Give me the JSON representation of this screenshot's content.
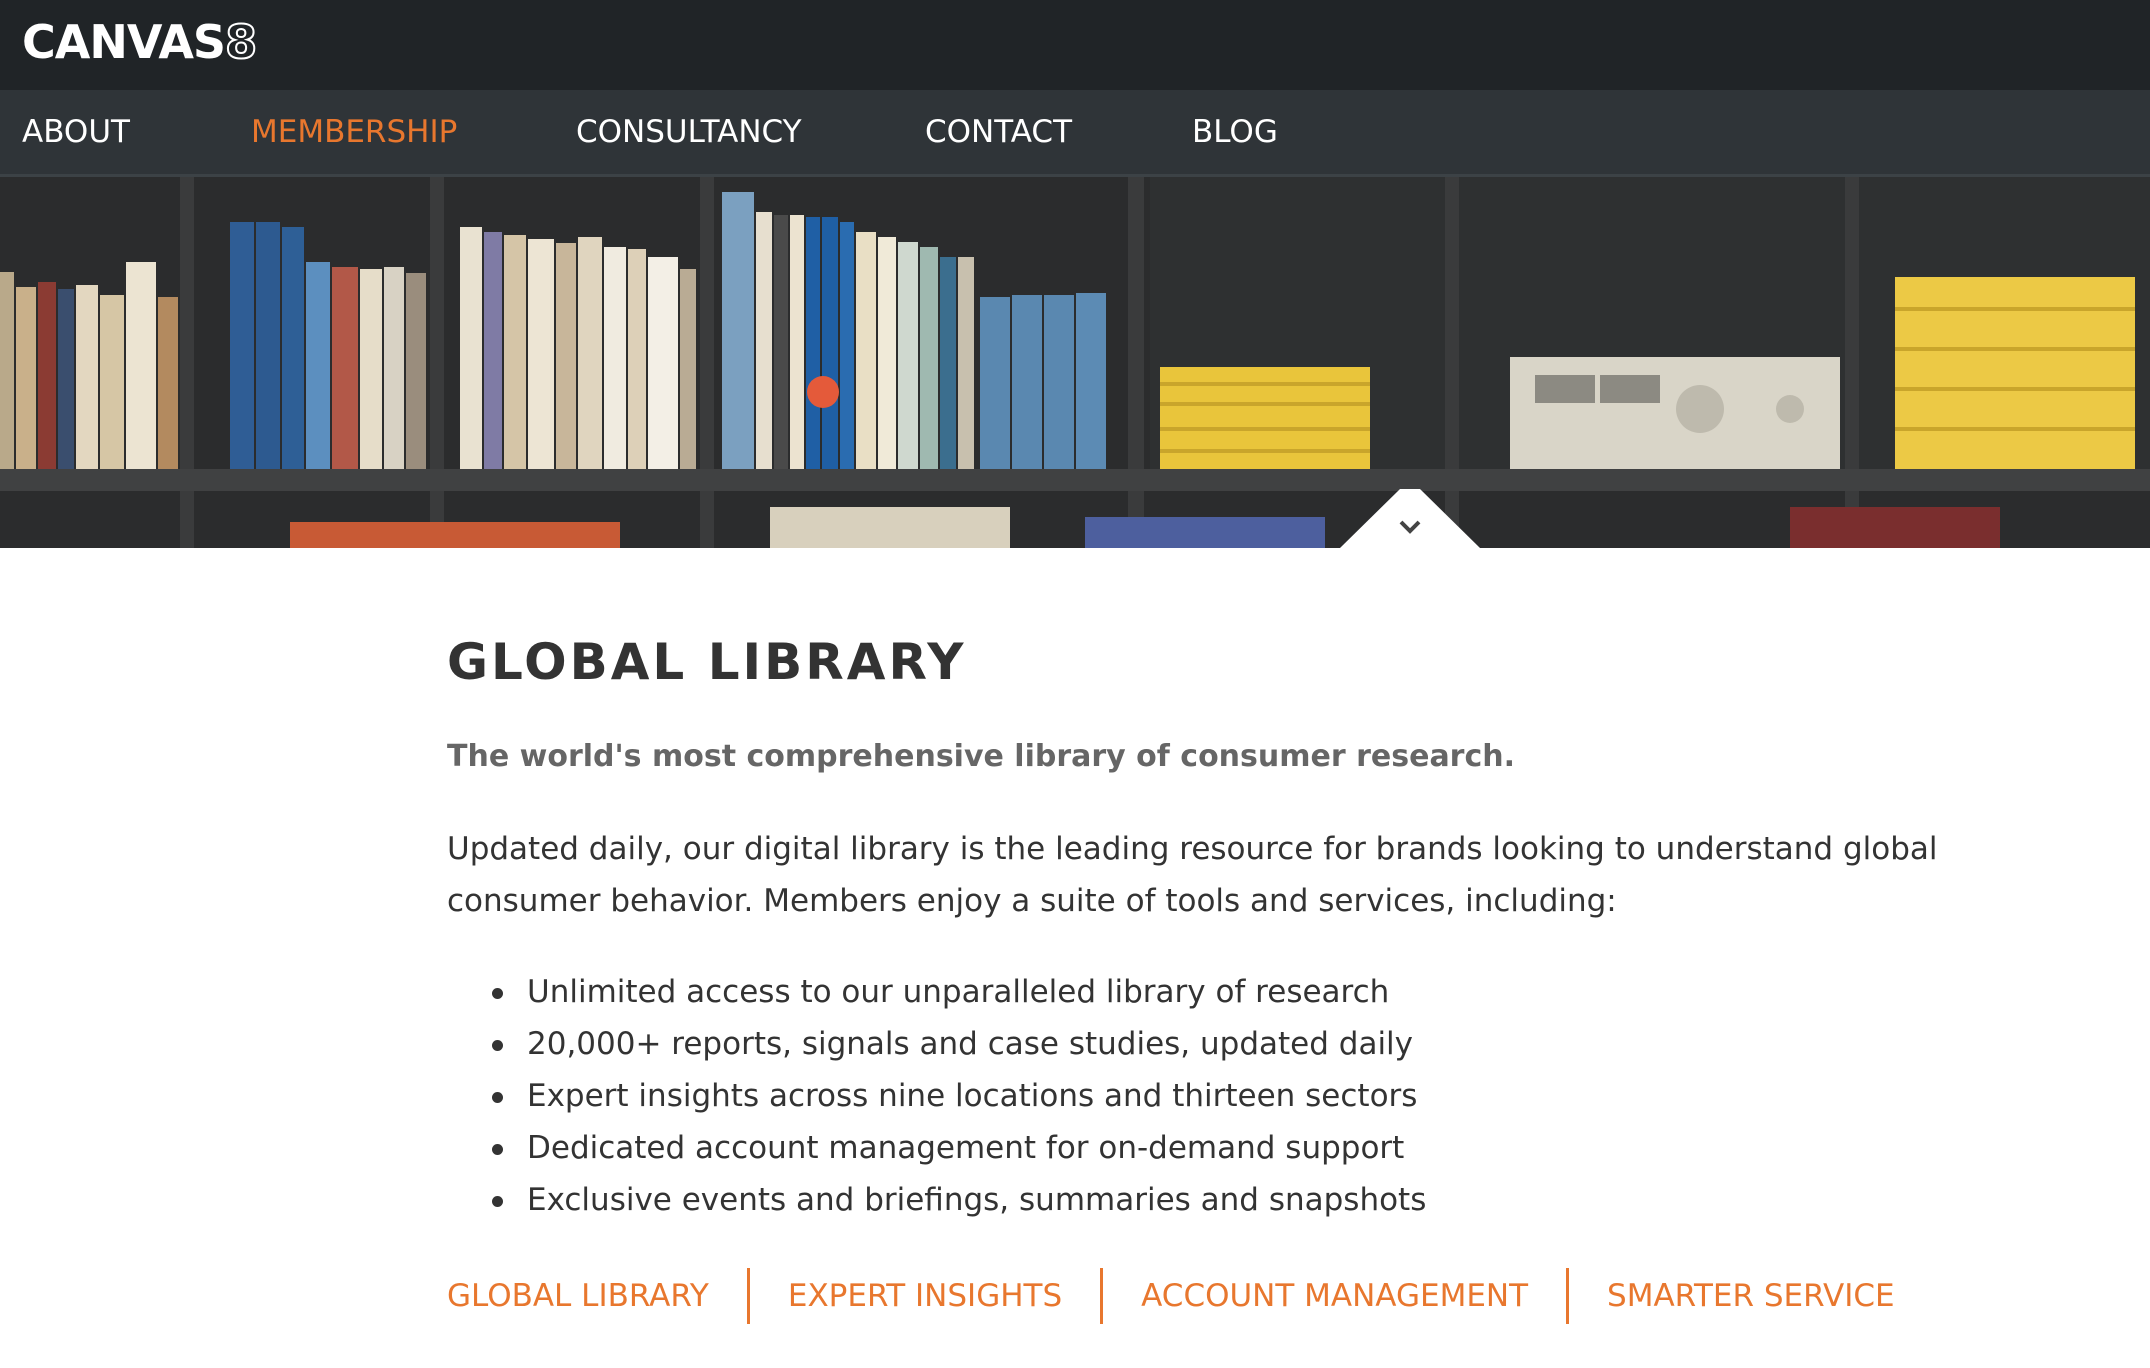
{
  "brand": {
    "logo_main": "CANVAS",
    "logo_num": "8"
  },
  "nav": {
    "items": [
      {
        "label": "ABOUT",
        "active": false
      },
      {
        "label": "MEMBERSHIP",
        "active": true
      },
      {
        "label": "CONSULTANCY",
        "active": false
      },
      {
        "label": "CONTACT",
        "active": false
      },
      {
        "label": "BLOG",
        "active": false
      }
    ]
  },
  "hero": {
    "image": "bookshelf-photo",
    "scroll_icon": "chevron-down-icon"
  },
  "main": {
    "title": "GLOBAL LIBRARY",
    "subtitle": "The world's most comprehensive library of consumer research.",
    "intro": "Updated daily, our digital library is the leading resource for brands looking to understand global consumer behavior. Members enjoy a suite of tools and services, including:",
    "features": [
      "Unlimited access to our unparalleled library of research",
      "20,000+ reports, signals and case studies, updated daily",
      "Expert insights across nine locations and thirteen sectors",
      "Dedicated account management for on-demand support",
      "Exclusive events and briefings, summaries and snapshots"
    ]
  },
  "subnav": {
    "items": [
      "GLOBAL LIBRARY",
      "EXPERT INSIGHTS",
      "ACCOUNT MANAGEMENT",
      "SMARTER SERVICE"
    ]
  },
  "colors": {
    "accent": "#e8772e",
    "topbar": "#202427",
    "navbar": "#2f3438",
    "text": "#333333",
    "subtitle": "#666666"
  }
}
